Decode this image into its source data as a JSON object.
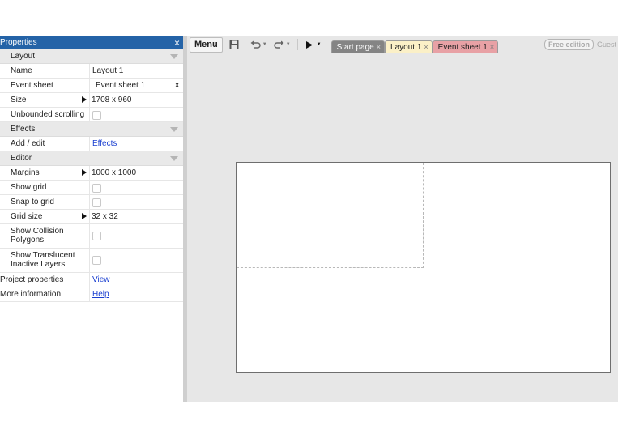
{
  "properties": {
    "title": "Properties",
    "close": "×",
    "sections": {
      "layout": {
        "label": "Layout",
        "name_key": "Name",
        "name_val": "Layout 1",
        "event_key": "Event sheet",
        "event_val": "Event sheet 1",
        "event_arrows": "⬍",
        "size_key": "Size",
        "size_val": "1708 x 960",
        "unbounded_key": "Unbounded scrolling"
      },
      "effects": {
        "label": "Effects",
        "add_key": "Add / edit",
        "add_val": "Effects"
      },
      "editor": {
        "label": "Editor",
        "margins_key": "Margins",
        "margins_val": "1000 x 1000",
        "show_grid_key": "Show grid",
        "snap_key": "Snap to grid",
        "grid_size_key": "Grid size",
        "grid_size_val": "32 x 32",
        "collision_key": "Show Collision Polygons",
        "translucent_key": "Show Translucent Inactive Layers"
      }
    },
    "project_key": "Project properties",
    "project_val": "View",
    "more_key": "More information",
    "more_val": "Help"
  },
  "toolbar": {
    "menu": "Menu",
    "tabs": [
      {
        "label": "Start page",
        "close": "×"
      },
      {
        "label": "Layout 1",
        "close": "×"
      },
      {
        "label": "Event sheet 1",
        "close": "×"
      }
    ],
    "free_edition": "Free edition",
    "guest": "Guest"
  },
  "colors": {
    "panel_header": "#2463a7",
    "tab_start": "#848484",
    "tab_layout": "#fbf0c7",
    "tab_event": "#e8a1a5",
    "link": "#1a3fd0"
  },
  "icons": [
    "close-icon",
    "save-icon",
    "undo-icon",
    "redo-icon",
    "play-icon",
    "expand-arrow-icon",
    "dropdown-arrows-icon"
  ]
}
